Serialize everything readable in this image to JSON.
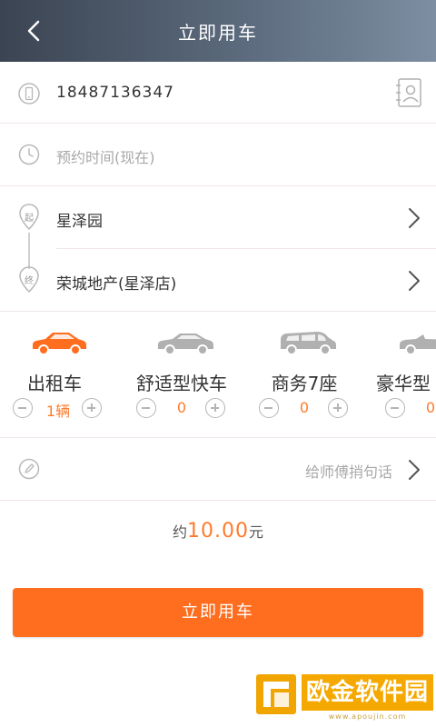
{
  "header": {
    "title": "立即用车",
    "back_icon": "chevron-left-icon"
  },
  "form": {
    "phone": {
      "value": "18487136347",
      "icon": "phone-icon",
      "contacts_icon": "contact-card-icon"
    },
    "time": {
      "placeholder": "预约时间(现在)",
      "icon": "clock-icon"
    },
    "start": {
      "badge": "起",
      "value": "星泽园"
    },
    "end": {
      "badge": "终",
      "value": "荣城地产(星泽店)"
    }
  },
  "car_types": [
    {
      "name": "出租车",
      "count": "1辆",
      "selected": true
    },
    {
      "name": "舒适型快车",
      "count": "0",
      "selected": false
    },
    {
      "name": "商务7座",
      "count": "0",
      "selected": false
    },
    {
      "name": "豪华型",
      "count": "0",
      "selected": false
    }
  ],
  "message": {
    "placeholder": "给师傅捎句话",
    "icon": "pencil-icon"
  },
  "price": {
    "prefix": "约",
    "amount": "10.00",
    "suffix": "元"
  },
  "submit": {
    "label": "立即用车"
  },
  "watermark": {
    "brand": "欧金软件园",
    "url": "www.apoujin.com"
  },
  "colors": {
    "accent": "#ff6d1f",
    "header": "#4a5565",
    "watermark": "#f5a800"
  }
}
